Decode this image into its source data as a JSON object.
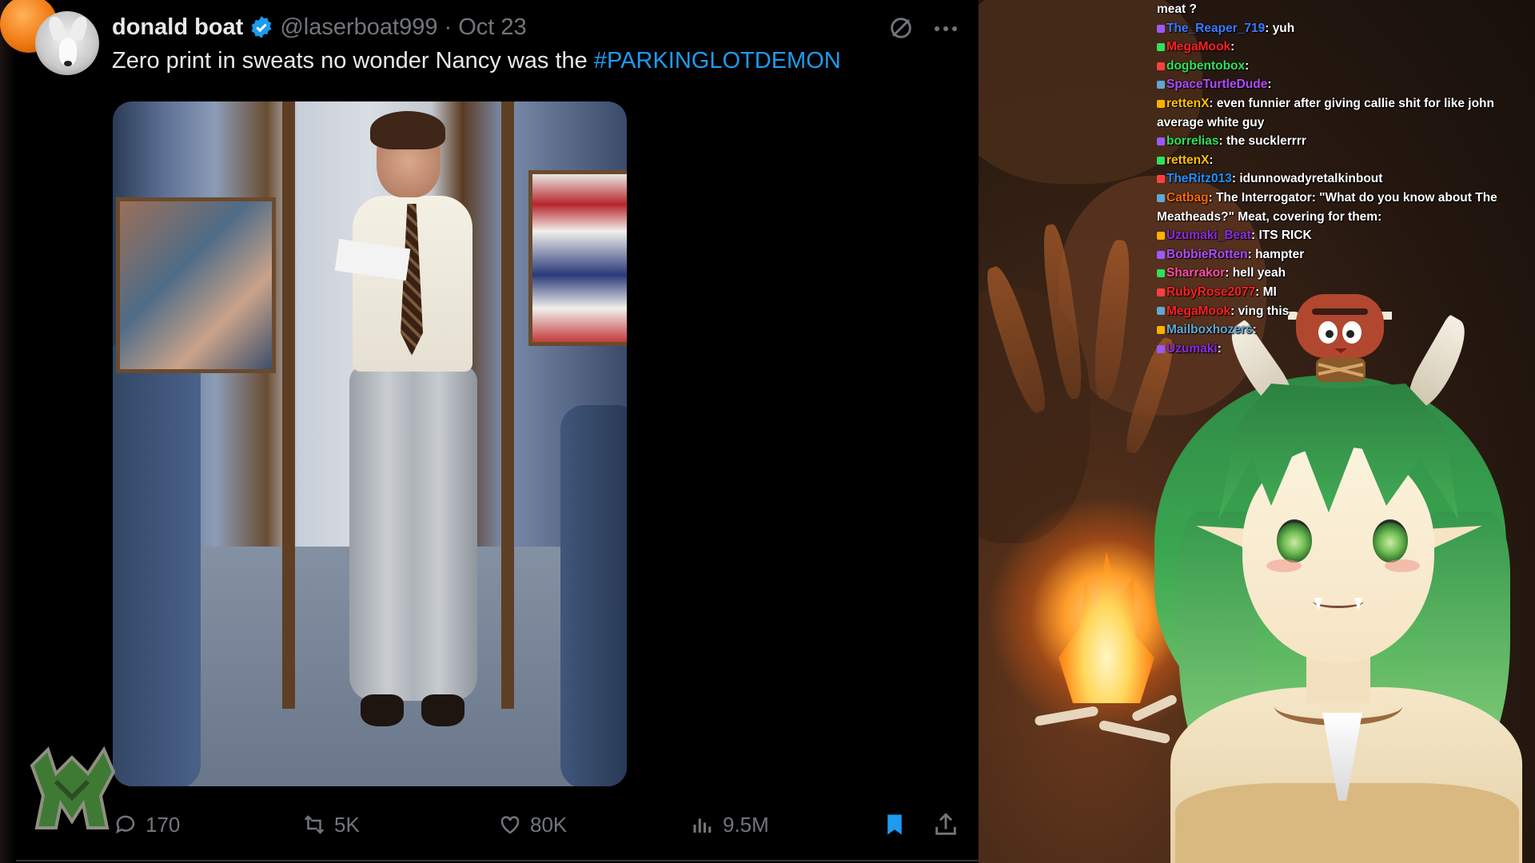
{
  "tweet": {
    "author": {
      "display_name": "donald boat",
      "handle": "@laserboat999",
      "date": "Oct 23",
      "verified_color": "#1d9bf0"
    },
    "text": "Zero print in sweats no wonder Nancy was the ",
    "hashtag": "#PARKINGLOTDEMON",
    "actions": {
      "replies": "170",
      "reposts": "5K",
      "likes": "80K",
      "views": "9.5M"
    },
    "icons": [
      "grok-icon",
      "more-icon",
      "reply-icon",
      "repost-icon",
      "like-icon",
      "views-icon",
      "bookmark-icon",
      "share-icon"
    ],
    "bookmark_color": "#1d9bf0"
  },
  "chat": {
    "messages": [
      {
        "user": "",
        "text": "meat ?",
        "color": "#ffffff"
      },
      {
        "user": "The_Reaper_719",
        "text": "yuh",
        "color": "#3b7bff"
      },
      {
        "user": "MegaMook",
        "text": "",
        "color": "#ff2020"
      },
      {
        "user": "dogbentobox",
        "text": "",
        "color": "#2fe05a"
      },
      {
        "user": "SpaceTurtleDude",
        "text": "",
        "color": "#b04bff"
      },
      {
        "user": "rettenX",
        "text": "even funnier after giving callie shit for like john average white guy",
        "color": "#ffc000"
      },
      {
        "user": "borrelias",
        "text": "the sucklerrrr",
        "color": "#2fe05a"
      },
      {
        "user": "rettenX",
        "text": "",
        "color": "#ffc000"
      },
      {
        "user": "TheRitz013",
        "text": "idunnowadyretalkinbout",
        "color": "#1e90ff"
      },
      {
        "user": "Catbag",
        "text": "The Interrogator: \"What do you know about The Meatheads?\" Meat, covering for them:",
        "color": "#ff6a00"
      },
      {
        "user": "Uzumaki_Beat",
        "text": "ITS RICK",
        "color": "#8a2be2"
      },
      {
        "user": "BobbieRotten",
        "text": "hampter",
        "color": "#b04bff"
      },
      {
        "user": "Sharrakor",
        "text": "hell yeah",
        "color": "#ff4fa0"
      },
      {
        "user": "RubyRose2077",
        "text": "MI",
        "color": "#ff2020"
      },
      {
        "user": "MegaMook",
        "text": "ving this",
        "color": "#ff2020"
      },
      {
        "user": "Mailboxhozers",
        "text": "",
        "color": "#5fa8d3"
      },
      {
        "user": "Uzumaki",
        "text": "",
        "color": "#8a2be2"
      }
    ]
  }
}
